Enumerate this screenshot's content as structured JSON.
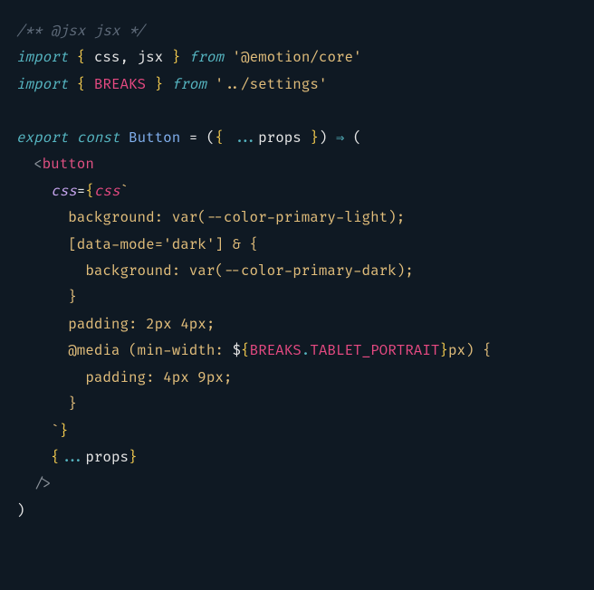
{
  "lines": {
    "l1_comment": "/** @jsx jsx */",
    "l2_import": "import",
    "l2_lbrace": " { ",
    "l2_css": "css",
    "l2_comma": ", ",
    "l2_jsx": "jsx",
    "l2_rbrace": " } ",
    "l2_from": "from",
    "l2_space": " ",
    "l2_pkg": "'@emotion/core'",
    "l3_import": "import",
    "l3_lbrace": " { ",
    "l3_breaks": "BREAKS",
    "l3_rbrace": " } ",
    "l3_from": "from",
    "l3_space": " ",
    "l3_pkg": "'../settings'",
    "l5_export": "export",
    "l5_space1": " ",
    "l5_const": "const",
    "l5_space2": " ",
    "l5_button": "Button",
    "l5_eq": " = ",
    "l5_lparen": "(",
    "l5_lbrace": "{ ",
    "l5_spread": "...",
    "l5_props": "props",
    "l5_rbrace": " }",
    "l5_rparen": ")",
    "l5_arrow": " ⇒ ",
    "l5_lparen2": "(",
    "l6_indent": "  ",
    "l6_lt": "<",
    "l6_button": "button",
    "l7_indent": "    ",
    "l7_cssattr": "css",
    "l7_eq": "=",
    "l7_lbrace": "{",
    "l7_cssfn": "css",
    "l7_backtick": "`",
    "l8_indent": "      ",
    "l8_text": "background: var(--color-primary-light);",
    "l9_indent": "      ",
    "l9_text": "[data-mode='dark'] & {",
    "l10_indent": "        ",
    "l10_text": "background: var(--color-primary-dark);",
    "l11_indent": "      ",
    "l11_text": "}",
    "l12_indent": "      ",
    "l12_text": "padding: 2px 4px;",
    "l13_indent": "      ",
    "l13_media": "@media (min-width: ",
    "l13_dollar": "$",
    "l13_lbrace": "{",
    "l13_breaks": "BREAKS",
    "l13_dot": ".",
    "l13_tablet": "TABLET_PORTRAIT",
    "l13_rbrace": "}",
    "l13_rest": "px) {",
    "l14_indent": "        ",
    "l14_text": "padding: 4px 9px;",
    "l15_indent": "      ",
    "l15_text": "}",
    "l16_indent": "    ",
    "l16_backtick": "`",
    "l16_rbrace": "}",
    "l17_indent": "    ",
    "l17_lbrace": "{",
    "l17_spread": "...",
    "l17_props": "props",
    "l17_rbrace": "}",
    "l18_indent": "  ",
    "l18_close": "/>",
    "l19_rparen": ")"
  }
}
